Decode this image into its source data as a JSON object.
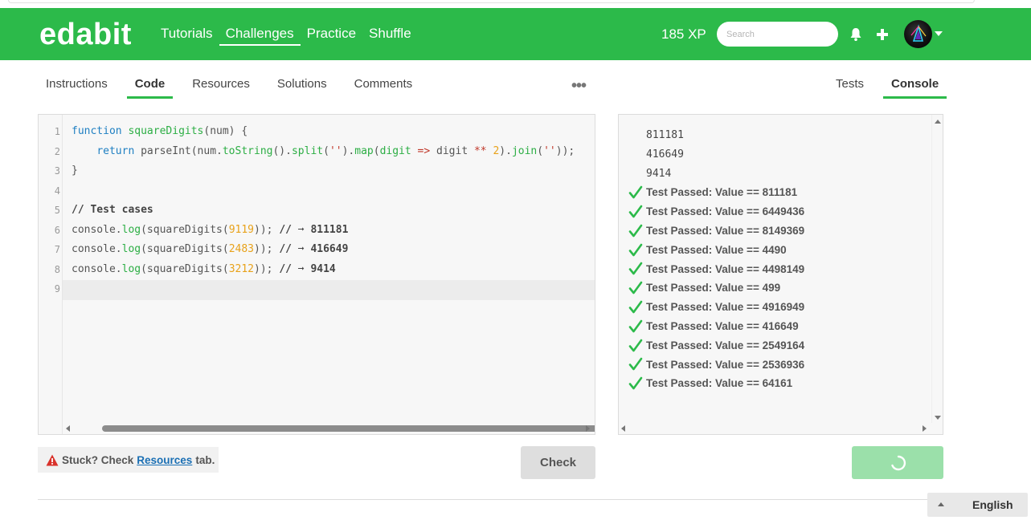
{
  "header": {
    "logo": "edabit",
    "nav": [
      "Tutorials",
      "Challenges",
      "Practice",
      "Shuffle"
    ],
    "active_nav": "Challenges",
    "xp": "185 XP",
    "search_placeholder": "Search",
    "brand_color": "#2cba4a"
  },
  "tabs_left": [
    "Instructions",
    "Code",
    "Resources",
    "Solutions",
    "Comments"
  ],
  "active_left_tab": "Code",
  "tabs_right": [
    "Tests",
    "Console"
  ],
  "active_right_tab": "Console",
  "editor": {
    "line_numbers": [
      "1",
      "2",
      "3",
      "4",
      "5",
      "6",
      "7",
      "8",
      "9"
    ],
    "lines": [
      "function squareDigits(num) {",
      "    return parseInt(num.toString().split('').map(digit => digit ** 2).join(''));",
      "}",
      "",
      "// Test cases",
      "console.log(squareDigits(9119)); // ➞ 811181",
      "console.log(squareDigits(2483)); // ➞ 416649",
      "console.log(squareDigits(3212)); // ➞ 9414",
      ""
    ]
  },
  "console": {
    "logs": [
      "811181",
      "416649",
      "9414"
    ],
    "results": [
      "Test Passed: Value == 811181",
      "Test Passed: Value == 6449436",
      "Test Passed: Value == 8149369",
      "Test Passed: Value == 4490",
      "Test Passed: Value == 4498149",
      "Test Passed: Value == 499",
      "Test Passed: Value == 4916949",
      "Test Passed: Value == 416649",
      "Test Passed: Value == 2549164",
      "Test Passed: Value == 2536936",
      "Test Passed: Value == 64161"
    ]
  },
  "footer": {
    "stuck_prefix": "Stuck? Check",
    "stuck_link": "Resources",
    "stuck_suffix": "tab.",
    "check_button": "Check",
    "language": "English"
  }
}
